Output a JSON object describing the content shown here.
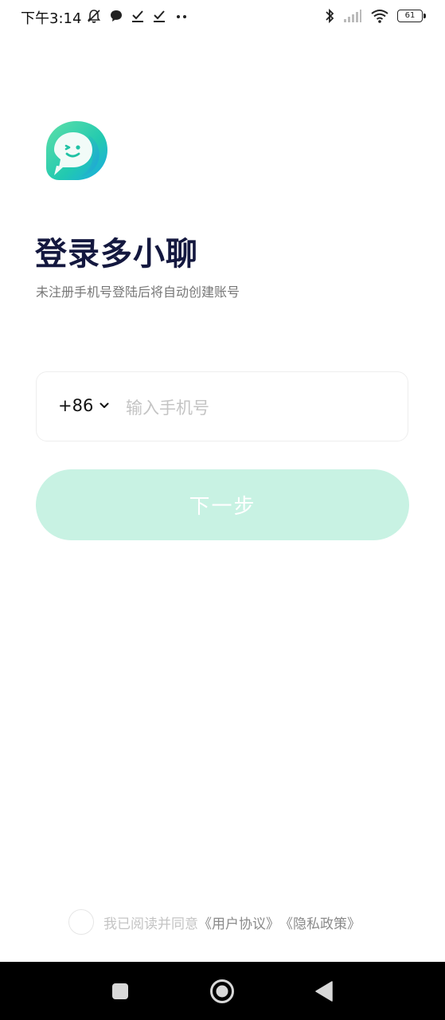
{
  "status_bar": {
    "time": "下午3:14",
    "battery_level": "61",
    "icons": [
      "mute-bell-icon",
      "chat-bubble-icon",
      "check-icon",
      "check-icon",
      "more-dots-icon",
      "bluetooth-icon",
      "signal-icon",
      "wifi-icon",
      "battery-icon"
    ]
  },
  "app": {
    "logo": "chat-bubble-smile-logo",
    "title": "登录多小聊",
    "subtitle": "未注册手机号登陆后将自动创建账号"
  },
  "phone_form": {
    "country_code": "+86",
    "placeholder": "输入手机号",
    "value": ""
  },
  "next_button": {
    "label": "下一步",
    "enabled": false,
    "color": "#c8f2e3"
  },
  "agreement": {
    "checked": false,
    "prefix": "我已阅读并同意",
    "user_agreement": "《用户协议》",
    "privacy_policy": "《隐私政策》"
  },
  "nav_bar": {
    "buttons": [
      "recents-square-icon",
      "home-circle-icon",
      "back-triangle-icon"
    ]
  },
  "colors": {
    "title": "#14183f",
    "accent": "#2fd3a0",
    "button_disabled": "#c8f2e3"
  }
}
